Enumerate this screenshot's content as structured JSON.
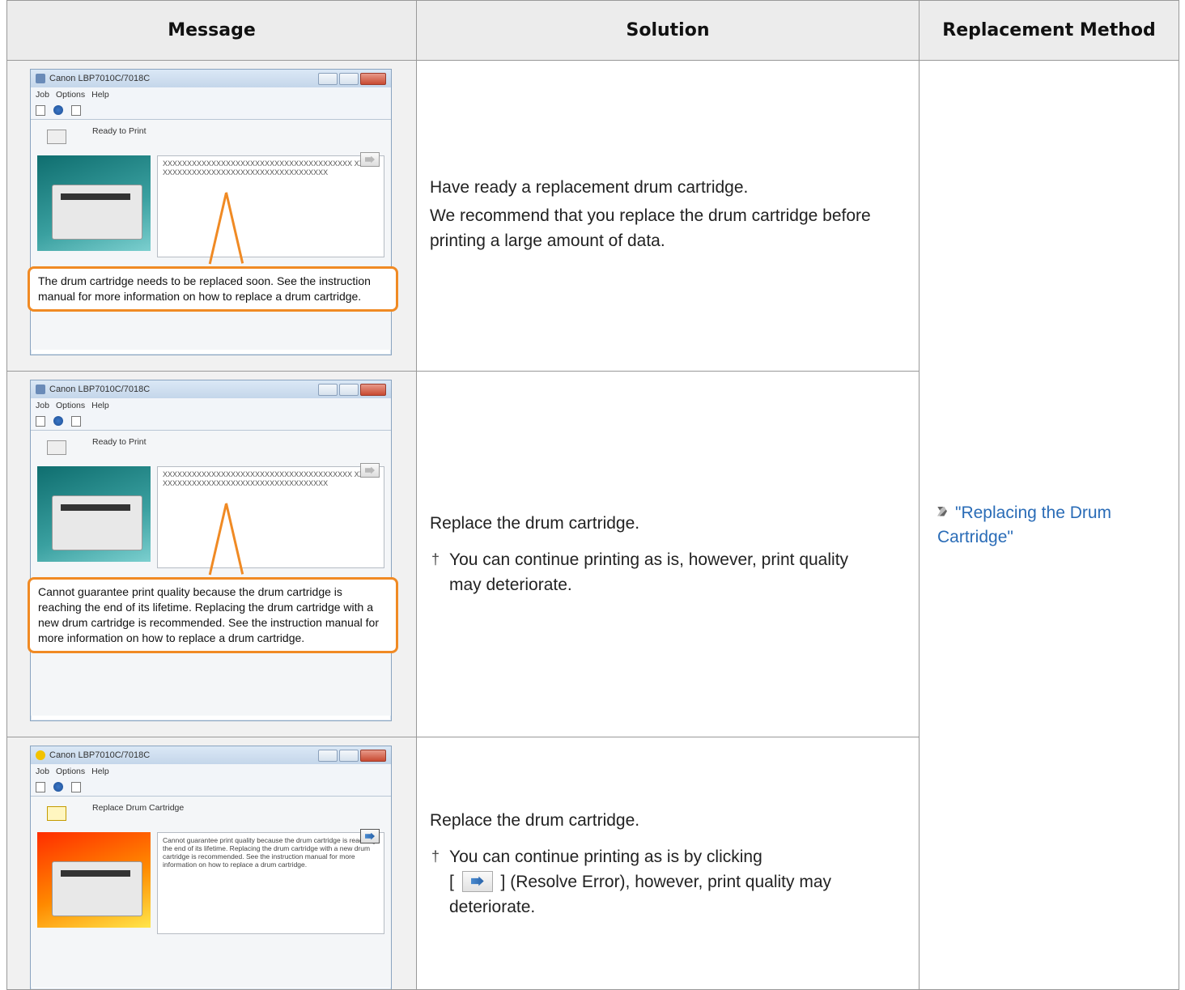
{
  "headers": {
    "message": "Message",
    "solution": "Solution",
    "replacement": "Replacement Method"
  },
  "window": {
    "title": "Canon LBP7010C/7018C",
    "menu": [
      "Job",
      "Options",
      "Help"
    ],
    "status_ready": "Ready to Print",
    "status_replace": "Replace Drum Cartridge",
    "placeholder_text": "XXXXXXXXXXXXXXXXXXXXXXXXXXXXXXXXXXXXXXX XXXXXXXXXXXXXXXXXXXXXXXXXXXXXXXXXXXXXXX"
  },
  "rows": [
    {
      "callout": "The drum cartridge needs to be replaced soon. See the instruction manual for more information on how to replace a drum cartridge.",
      "solution_p1": "Have ready a replacement drum cartridge.",
      "solution_p2": "We recommend that you replace the drum cartridge before printing a large amount of data."
    },
    {
      "callout": "Cannot guarantee print quality because the drum cartridge is reaching the end of its lifetime. Replacing the drum cartridge with a new drum cartridge is recommended. See the instruction manual for more information on how to replace a drum cartridge.",
      "solution_p1": "Replace the drum cartridge.",
      "note": "You can continue printing as is, however, print quality may deteriorate."
    },
    {
      "window_message": "Cannot guarantee print quality because the drum cartridge is reaching the end of its lifetime. Replacing the drum cartridge with a new drum cartridge is recommended. See the instruction manual for more information on how to replace a drum cartridge.",
      "solution_p1": "Replace the drum cartridge.",
      "note_before": "You can continue printing as is by clicking",
      "note_bracket_open": "[",
      "note_after": "] (Resolve Error), however, print quality may deteriorate."
    }
  ],
  "replacement_link": "\"Replacing the Drum Cartridge\"",
  "dagger": "†",
  "colors": {
    "callout": "#f08a24",
    "link": "#2a6cb7",
    "header_bg": "#ececec",
    "message_bg": "#f1f1f1"
  },
  "icons": [
    "printer-icon",
    "resolve-error-icon",
    "warning-icon",
    "refresh-icon",
    "link-arrow-icon"
  ]
}
